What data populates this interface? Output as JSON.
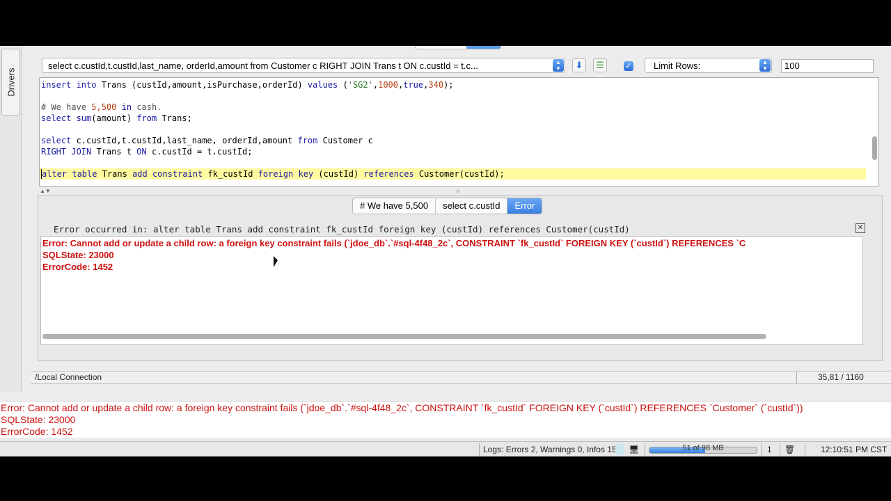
{
  "app": {
    "drivers_tab": "Drivers",
    "toolbar": {
      "query_selector": "select c.custId,t.custId,last_name, orderId,amount from Customer c RIGHT JOIN Trans t ON c.custId = t.c...",
      "limit_rows_label": "Limit Rows:",
      "limit_rows_value": "100",
      "limit_checked": true
    },
    "editor": {
      "lines": [
        "insert into Trans (custId,amount,isPurchase,orderId) values ('SG2',1000,true,340);",
        "",
        "# We have 5,500 in cash.",
        "select sum(amount) from Trans;",
        "",
        "select c.custId,t.custId,last_name, orderId,amount from Customer c",
        "RIGHT JOIN Trans t ON c.custId = t.custId;",
        "",
        "alter table Trans add constraint fk_custId foreign key (custId) references Customer(custId);"
      ]
    },
    "result_tabs": [
      "# We have 5,500",
      "select c.custId",
      "Error"
    ],
    "active_result_tab": "Error",
    "error_header": "Error occurred in: alter table Trans add constraint fk_custId foreign key (custId) references Customer(custId)",
    "error_lines": [
      "Error: Cannot add or update a child row: a foreign key constraint fails (`jdoe_db`.`#sql-4f48_2c`, CONSTRAINT `fk_custId` FOREIGN KEY (`custId`) REFERENCES `C",
      "SQLState:  23000",
      "ErrorCode: 1452"
    ],
    "connection": "/Local Connection",
    "cursor_position": "35,81 / 1160",
    "log_lines": [
      "Error: Cannot add or update a child row: a foreign key constraint fails (`jdoe_db`.`#sql-4f48_2c`, CONSTRAINT `fk_custId` FOREIGN KEY (`custId`) REFERENCES `Customer` (`custId`))",
      "SQLState:  23000",
      "ErrorCode: 1452"
    ],
    "status": {
      "logs": "Logs: Errors 2, Warnings 0, Infos 15",
      "memory": "51 of 98 MB",
      "memory_fraction": 0.52,
      "count": "1",
      "time": "12:10:51 PM CST"
    },
    "colors": {
      "accent": "#3b7fe0",
      "error": "#cc1111",
      "highlight": "#fffaa0"
    }
  }
}
